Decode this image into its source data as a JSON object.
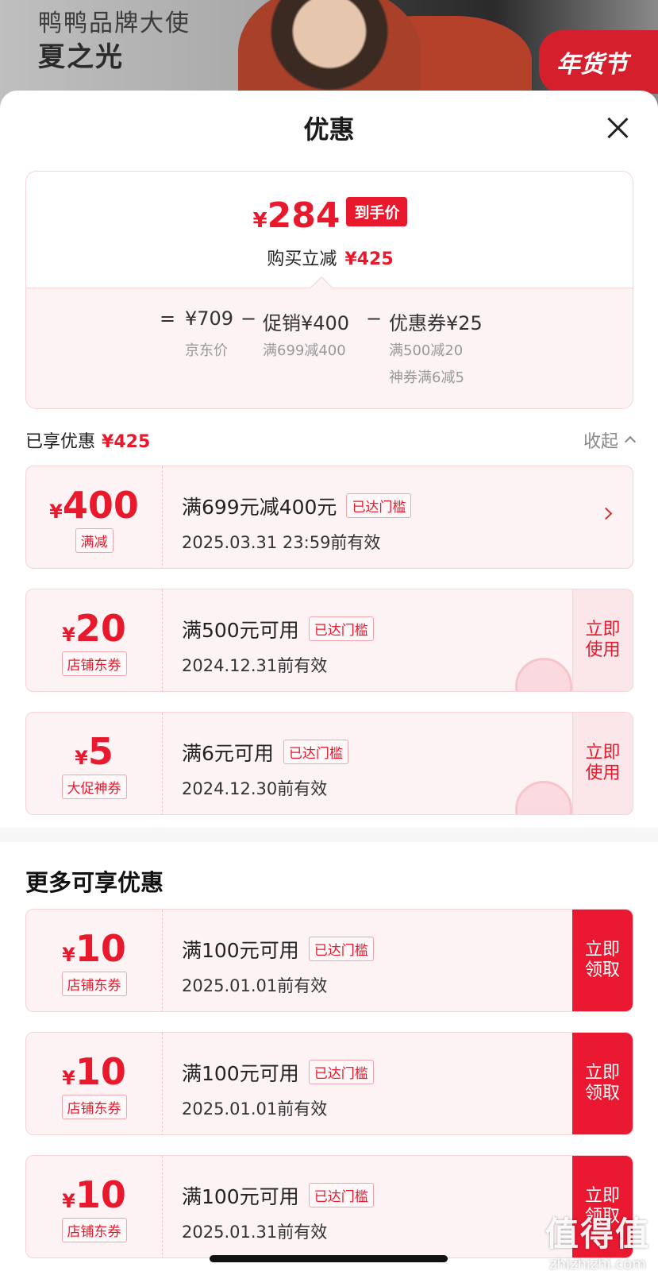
{
  "banner": {
    "line1": "鸭鸭品牌大使",
    "line2": "夏之光",
    "tag": "年货节"
  },
  "sheet": {
    "title": "优惠"
  },
  "price": {
    "currency": "¥",
    "final": "284",
    "final_tag": "到手价",
    "reduce_label": "购买立减",
    "reduce_amount": "¥425",
    "eq": "=",
    "jd_price": "¥709",
    "jd_label": "京东价",
    "minus": "−",
    "promo": "促销¥400",
    "promo_rule": "满699减400",
    "coupon": "优惠券¥25",
    "coupon_rule1": "满500减20",
    "coupon_rule2": "神券满6减5"
  },
  "enjoyed": {
    "label": "已享优惠",
    "amount": "¥425",
    "collapse": "收起"
  },
  "coupons": [
    {
      "currency": "¥",
      "value": "400",
      "kind": "满减",
      "cond": "满699元减400元",
      "reach": "已达门槛",
      "expire": "2025.03.31 23:59前有效"
    },
    {
      "currency": "¥",
      "value": "20",
      "kind": "店铺东券",
      "cond": "满500元可用",
      "reach": "已达门槛",
      "expire": "2024.12.31前有效",
      "action": "立即\n使用"
    },
    {
      "currency": "¥",
      "value": "5",
      "kind": "大促神券",
      "cond": "满6元可用",
      "reach": "已达门槛",
      "expire": "2024.12.30前有效",
      "action": "立即\n使用"
    }
  ],
  "more": {
    "title": "更多可享优惠",
    "items": [
      {
        "currency": "¥",
        "value": "10",
        "kind": "店铺东券",
        "cond": "满100元可用",
        "reach": "已达门槛",
        "expire": "2025.01.01前有效",
        "action": "立即\n领取"
      },
      {
        "currency": "¥",
        "value": "10",
        "kind": "店铺东券",
        "cond": "满100元可用",
        "reach": "已达门槛",
        "expire": "2025.01.01前有效",
        "action": "立即\n领取"
      },
      {
        "currency": "¥",
        "value": "10",
        "kind": "店铺东券",
        "cond": "满100元可用",
        "reach": "已达门槛",
        "expire": "2025.01.31前有效",
        "action": "立即\n领取"
      }
    ]
  },
  "watermark": {
    "big": "值得值",
    "small": "zhizhizhi.com"
  },
  "colors": {
    "accent": "#e8192c",
    "card_bg": "#fdf3f4",
    "card_border": "#f5d3d7"
  }
}
